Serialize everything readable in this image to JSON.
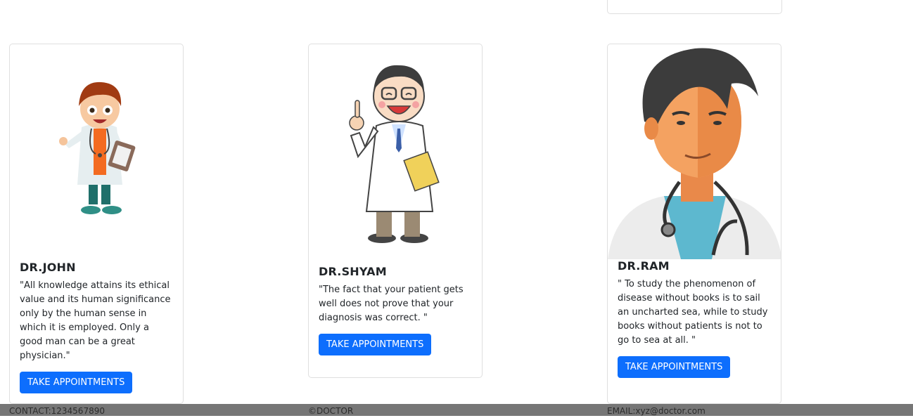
{
  "doctors": [
    {
      "name": "DR.JOHN",
      "quote": "\"All knowledge attains its ethical value and its human significance only by the human sense in which it is employed. Only a good man can be a great physician.\"",
      "button_label": "TAKE APPOINTMENTS"
    },
    {
      "name": "DR.SHYAM",
      "quote": "\"The fact that your patient gets well does not prove that your diagnosis was correct. \"",
      "button_label": "TAKE APPOINTMENTS"
    },
    {
      "name": "DR.RAM",
      "quote": "\" To study the phenomenon of disease without books is to sail an uncharted sea, while to study books without patients is not to go to sea at all. \"",
      "button_label": "TAKE APPOINTMENTS"
    }
  ],
  "footer": {
    "contact": "CONTACT:1234567890",
    "copyright": "©DOCTOR",
    "email": "EMAIL:xyz@doctor.com"
  },
  "colors": {
    "button": "#0d6efd",
    "footer_bg": "#767676"
  }
}
